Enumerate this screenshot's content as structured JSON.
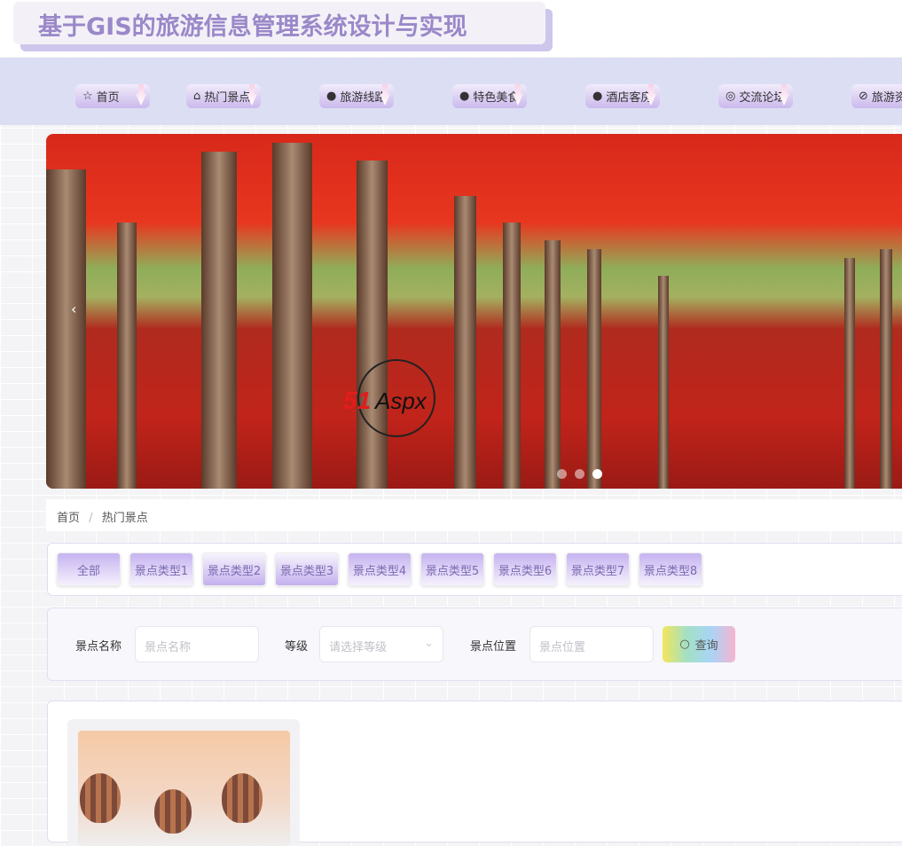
{
  "header": {
    "title": "基于GIS的旅游信息管理系统设计与实现"
  },
  "nav": {
    "items": [
      {
        "icon": "star-icon",
        "glyph": "☆",
        "label": "首页"
      },
      {
        "icon": "bag-icon",
        "glyph": "⌂",
        "label": "热门景点"
      },
      {
        "icon": "info-icon",
        "glyph": "●",
        "label": "旅游线路"
      },
      {
        "icon": "question-icon",
        "glyph": "●",
        "label": "特色美食"
      },
      {
        "icon": "info-icon",
        "glyph": "●",
        "label": "酒店客房"
      },
      {
        "icon": "chat-icon",
        "glyph": "◎",
        "label": "交流论坛"
      },
      {
        "icon": "check-circle-icon",
        "glyph": "⊘",
        "label": "旅游资讯"
      }
    ]
  },
  "carousel": {
    "prev": "‹",
    "slides": 3,
    "active": 3,
    "watermark": "51Aspx"
  },
  "breadcrumb": {
    "home": "首页",
    "sep": "/",
    "current": "热门景点"
  },
  "filters": {
    "tabs": [
      "全部",
      "景点类型1",
      "景点类型2",
      "景点类型3",
      "景点类型4",
      "景点类型5",
      "景点类型6",
      "景点类型7",
      "景点类型8"
    ]
  },
  "search": {
    "name_label": "景点名称",
    "name_placeholder": "景点名称",
    "level_label": "等级",
    "level_placeholder": "请选择等级",
    "location_label": "景点位置",
    "location_placeholder": "景点位置",
    "query_label": "查询"
  }
}
